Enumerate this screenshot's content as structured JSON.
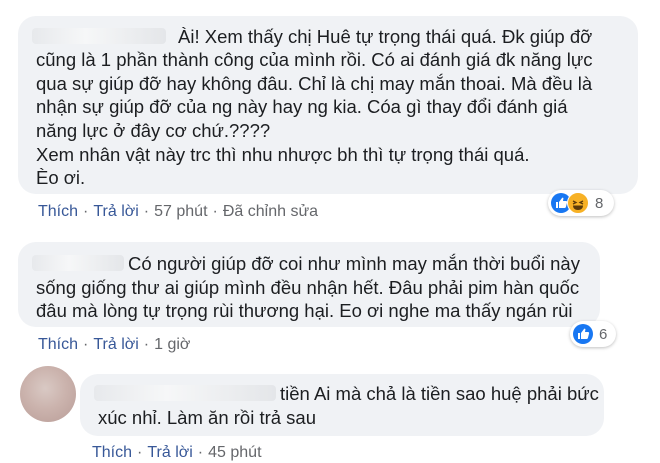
{
  "comments": [
    {
      "text_lines": [
        "Ài! Xem thấy chị Huê tự trọng thái quá. Đk giúp đỡ",
        "cũng là 1 phần thành công của mình rồi. Có ai đánh giá đk năng lực",
        "qua sự giúp đỡ hay không đâu. Chỉ là chị may mắn thoai. Mà đều là",
        "nhận sự giúp đỡ của ng này hay ng kia. Cóa gì thay đổi đánh giá",
        "năng lực ở đây cơ chứ.????",
        "Xem nhân vật này trc thì nhu nhược bh thì tự trọng thái quá.",
        "Èo ơi."
      ],
      "like_label": "Thích",
      "reply_label": "Trả lời",
      "time": "57 phút",
      "edited": "Đã chỉnh sửa",
      "reaction_count": "8",
      "reaction_icons": [
        "like-icon",
        "haha-icon"
      ]
    },
    {
      "text_lines": [
        "Có người giúp đỡ coi như mình may mắn thời buổi này",
        "sống giống thư ai giúp mình đều nhận hết. Đâu phải pim hàn quốc",
        "đâu mà lòng tự trọng rùi thương hại. Eo ơi nghe ma thấy ngán rùi"
      ],
      "like_label": "Thích",
      "reply_label": "Trả lời",
      "time": "1 giờ",
      "reaction_count": "6",
      "reaction_icons": [
        "like-icon"
      ]
    },
    {
      "text_lines": [
        "tiền Ai mà chả là tiền sao huệ phải bức",
        "xúc nhỉ. Làm ăn rồi trả sau"
      ],
      "like_label": "Thích",
      "reply_label": "Trả lời",
      "time": "45 phút"
    }
  ],
  "colors": {
    "bubble_bg": "#f0f2f5",
    "link": "#385898",
    "meta": "#65676b",
    "like_blue": "#1877f2",
    "haha_yellow": "#f7b125"
  }
}
